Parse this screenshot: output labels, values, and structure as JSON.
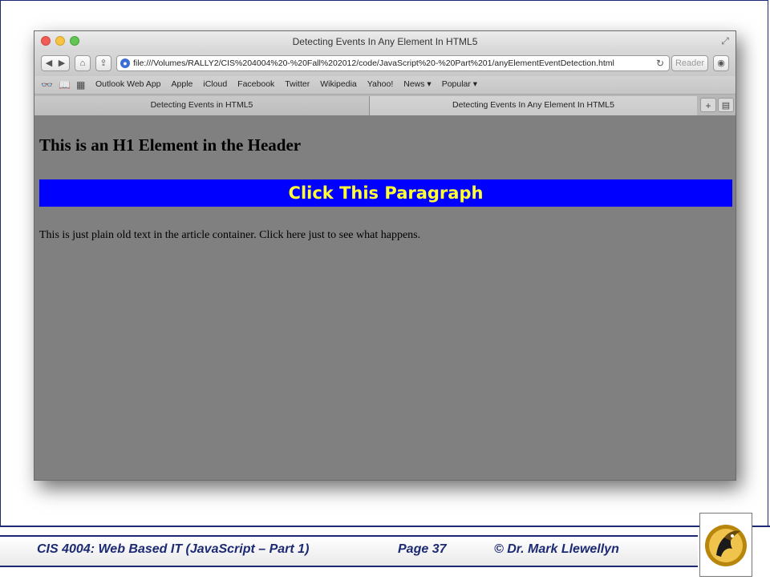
{
  "browser": {
    "window_title": "Detecting Events In Any Element In HTML5",
    "url": "file:///Volumes/RALLY2/CIS%204004%20-%20Fall%202012/code/JavaScript%20-%20Part%201/anyElementEventDetection.html",
    "reader_label": "Reader",
    "bookmarks": [
      "Outlook Web App",
      "Apple",
      "iCloud",
      "Facebook",
      "Twitter",
      "Wikipedia",
      "Yahoo!",
      "News ▾",
      "Popular ▾"
    ],
    "tabs": [
      {
        "label": "Detecting Events in HTML5",
        "active": false
      },
      {
        "label": "Detecting Events In Any Element In HTML5",
        "active": true
      }
    ]
  },
  "page": {
    "h1": "This is an H1 Element in the Header",
    "click_paragraph": "Click This Paragraph",
    "plain_text": "This is just plain old text in the article container. Click here just to see what happens."
  },
  "footer": {
    "course": "CIS 4004: Web Based IT (JavaScript – Part 1)",
    "page": "Page 37",
    "author": "© Dr. Mark Llewellyn"
  },
  "colors": {
    "paragraph_bg": "#0000ff",
    "paragraph_text": "#ffff33",
    "content_bg": "#808080",
    "footer_text": "#1c2a73"
  }
}
